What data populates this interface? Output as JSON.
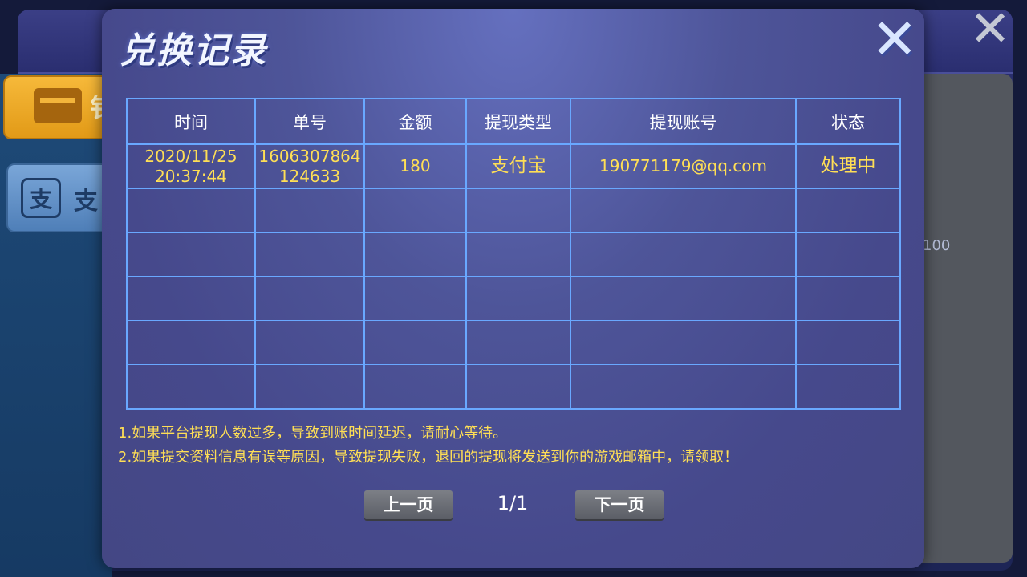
{
  "background": {
    "left_tab_label": "钅",
    "alipay_icon_glyph": "支",
    "alipay_tab_label": "支",
    "right_panel_text": "100",
    "close_glyph": "✕"
  },
  "modal": {
    "title": "兑换记录",
    "close_glyph": "✕",
    "table": {
      "headers": [
        "时间",
        "单号",
        "金额",
        "提现类型",
        "提现账号",
        "状态"
      ],
      "rows": [
        {
          "time": "2020/11/25\n20:37:44",
          "order_no": "1606307864\n124633",
          "amount": "180",
          "type": "支付宝",
          "account": "190771179@qq.com",
          "status": "处理中"
        }
      ],
      "empty_rows": 5
    },
    "notices": [
      "1.如果平台提现人数过多，导致到账时间延迟，请耐心等待。",
      "2.如果提交资料信息有误等原因，导致提现失败，退回的提现将发送到你的游戏邮箱中，请领取！"
    ],
    "pagination": {
      "prev_label": "上一页",
      "next_label": "下一页",
      "indicator": "1/1"
    }
  },
  "colors": {
    "accent_yellow": "#ffdf55",
    "table_border": "#69a8ff",
    "modal_bg": "#4e5599"
  }
}
